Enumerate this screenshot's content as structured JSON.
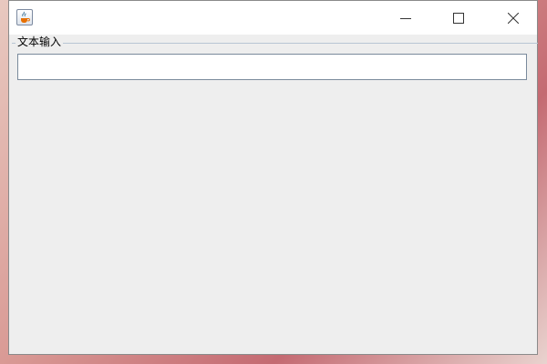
{
  "window": {
    "title": "",
    "icon": "java-cup-icon",
    "controls": {
      "minimize": "minimize-icon",
      "maximize": "maximize-icon",
      "close": "close-icon"
    }
  },
  "panel": {
    "legend": "文本输入",
    "input": {
      "value": "",
      "placeholder": ""
    }
  }
}
